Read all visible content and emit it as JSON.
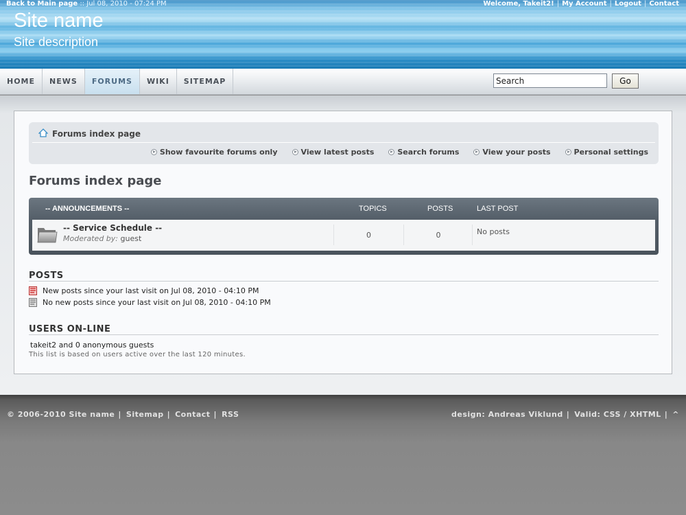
{
  "header": {
    "top_left_link": "Back to Main page",
    "top_left_sep": "::",
    "datetime": "Jul 08, 2010 - 07:24 PM",
    "welcome": "Welcome, Takeit2!",
    "my_account": "My Account",
    "logout": "Logout",
    "contact": "Contact",
    "site_name": "Site name",
    "site_description": "Site description"
  },
  "nav": {
    "items": [
      {
        "label": "HOME"
      },
      {
        "label": "NEWS"
      },
      {
        "label": "FORUMS",
        "active": true
      },
      {
        "label": "WIKI"
      },
      {
        "label": "SITEMAP"
      }
    ],
    "search_value": "Search",
    "go_label": "Go"
  },
  "breadcrumb": {
    "title": "Forums index page",
    "links": [
      "Show favourite forums only",
      "View latest posts",
      "Search forums",
      "View your posts",
      "Personal settings"
    ]
  },
  "page_title": "Forums index page",
  "forum_table": {
    "category": "-- ANNOUNCEMENTS --",
    "col_topics": "TOPICS",
    "col_posts": "POSTS",
    "col_last_post": "LAST POST",
    "rows": [
      {
        "name": "-- Service Schedule --",
        "moderated_label": "Moderated by:",
        "moderator": "guest",
        "topics": "0",
        "posts": "0",
        "last_post": "No posts"
      }
    ]
  },
  "posts_section": {
    "heading": "POSTS",
    "new_posts": "New posts since your last visit on Jul 08, 2010 - 04:10 PM",
    "no_new_posts": "No new posts since your last visit on Jul 08, 2010 - 04:10 PM"
  },
  "online_section": {
    "heading": "USERS ON-LINE",
    "summary": "takeit2 and 0 anonymous guests",
    "note": "This list is based on users active over the last 120 minutes."
  },
  "footer": {
    "copyright": "© 2006-2010 Site name",
    "sitemap": "Sitemap",
    "contact": "Contact",
    "rss": "RSS",
    "design": "design: Andreas Viklund",
    "valid": "Valid:",
    "css": "CSS",
    "slash": "/",
    "xhtml": "XHTML",
    "top_arrow": "^"
  },
  "colors": {
    "header_blue": "#2d8fc8",
    "nav_active": "#c8dfee",
    "table_dark": "#535d67",
    "footer_gray": "#888888"
  }
}
